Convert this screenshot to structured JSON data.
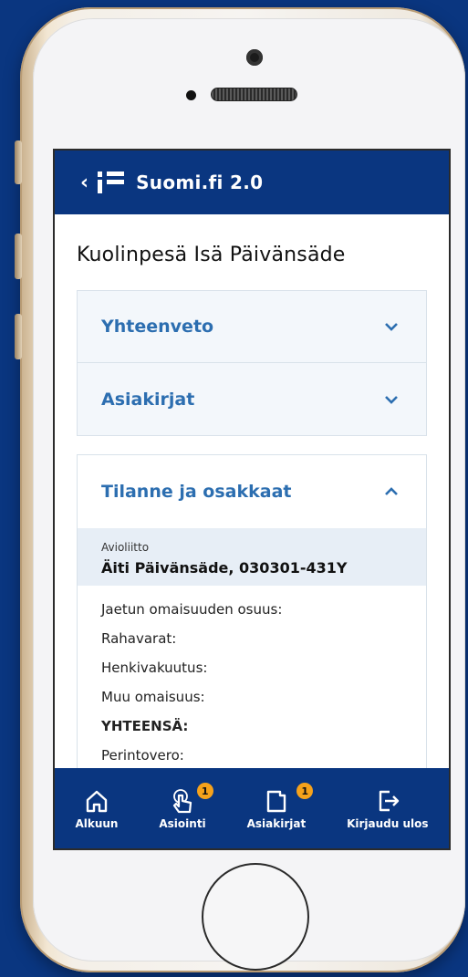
{
  "header": {
    "back_icon": "chevron-left-icon",
    "logo_icon": "suomi-logo-icon",
    "brand": "Suomi.fi 2.0"
  },
  "page": {
    "title": "Kuolinpesä Isä Päivänsäde"
  },
  "accordions": [
    {
      "label": "Yhteenveto",
      "expanded": false
    },
    {
      "label": "Asiakirjat",
      "expanded": false
    }
  ],
  "panel": {
    "label": "Tilanne ja osakkaat",
    "expanded": true,
    "info_label": "Avioliitto",
    "person": "Äiti Päivänsäde, 030301-431Y",
    "rows": [
      {
        "label": "Jaetun omaisuuden osuus:",
        "bold": false
      },
      {
        "label": "Rahavarat:",
        "bold": false
      },
      {
        "label": "Henkivakuutus:",
        "bold": false
      },
      {
        "label": "Muu omaisuus:",
        "bold": false
      },
      {
        "label": "YHTEENSÄ:",
        "bold": true
      },
      {
        "label": "Perintovero:",
        "bold": false
      }
    ]
  },
  "nav": [
    {
      "label": "Alkuun",
      "icon": "home-icon",
      "badge": ""
    },
    {
      "label": "Asiointi",
      "icon": "touch-hand-icon",
      "badge": "1"
    },
    {
      "label": "Asiakirjat",
      "icon": "document-icon",
      "badge": "1"
    },
    {
      "label": "Kirjaudu ulos",
      "icon": "logout-icon",
      "badge": ""
    }
  ],
  "colors": {
    "primary": "#0a3680",
    "link": "#2c6eb0",
    "badge": "#f6a21b",
    "panel_bg": "#f3f7fb"
  }
}
